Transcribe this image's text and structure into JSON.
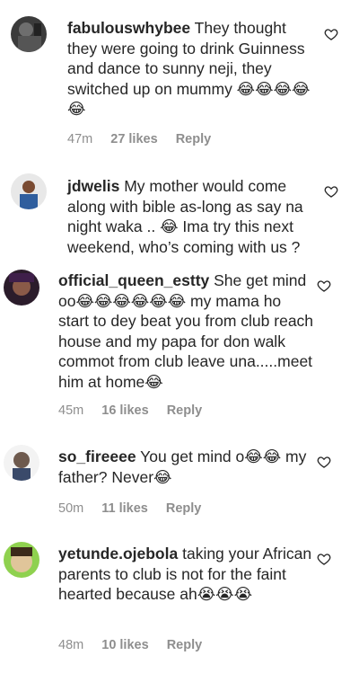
{
  "comments": [
    {
      "username": "fabulouswhybee",
      "text": "They thought they were going to drink Guinness and dance to sunny neji, they switched up on mummy 😂😂😂😂😂",
      "time": "47m",
      "likes": "27 likes",
      "reply": "Reply"
    },
    {
      "username": "jdwelis",
      "text": "My mother would come along with bible as-long as say na night waka .. 😂 Ima try this next weekend, who’s coming with us ?",
      "time": "",
      "likes": "",
      "reply": ""
    },
    {
      "username": "official_queen_estty",
      "text": "She get mind oo😂😂😂😂😂😂 my mama ho start to dey beat you from club reach house and my papa for don walk commot from club leave una.....meet him at home😂",
      "time": "45m",
      "likes": "16 likes",
      "reply": "Reply"
    },
    {
      "username": "so_fireeee",
      "text": "You get mind o😂😂 my father? Never😂",
      "time": "50m",
      "likes": "11 likes",
      "reply": "Reply"
    },
    {
      "username": "yetunde.ojebola",
      "text": "taking your African parents to club is not for the faint hearted because ah😭😭😭",
      "time": "48m",
      "likes": "10 likes",
      "reply": "Reply"
    }
  ],
  "icons": {
    "like": "heart-outline-icon",
    "avatar": "user-avatar"
  },
  "colors": {
    "text": "#262626",
    "meta": "#8e8e8e"
  }
}
